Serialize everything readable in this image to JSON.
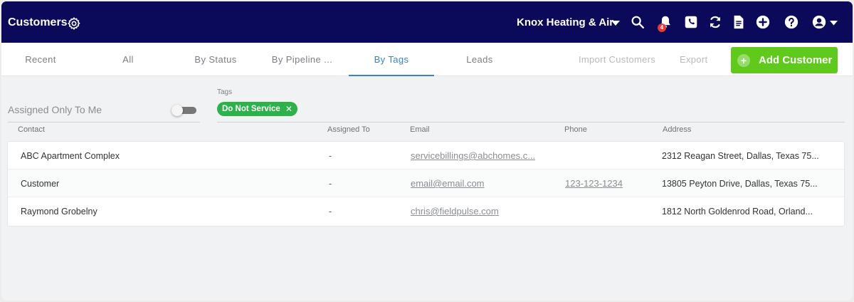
{
  "header": {
    "title": "Customers",
    "company": "Knox Heating & Air",
    "notification_count": "4",
    "icons": [
      "gear-icon",
      "caret-down-icon",
      "search-icon",
      "bell-icon",
      "phone-icon",
      "sync-icon",
      "document-icon",
      "plus-circle-icon",
      "help-icon",
      "user-account-icon"
    ]
  },
  "tabs": [
    {
      "label": "Recent"
    },
    {
      "label": "All"
    },
    {
      "label": "By Status"
    },
    {
      "label": "By Pipeline ..."
    },
    {
      "label": "By Tags"
    },
    {
      "label": "Leads"
    }
  ],
  "active_tab": "By Tags",
  "actions": {
    "import": "Import Customers",
    "export": "Export",
    "add": "Add Customer"
  },
  "filters": {
    "assigned_label": "Assigned Only To Me",
    "assigned_on": false,
    "tags_label": "Tags",
    "tag": "Do Not Service"
  },
  "table": {
    "columns": [
      "Contact",
      "Assigned To",
      "Email",
      "Phone",
      "Address"
    ],
    "rows": [
      {
        "contact": "ABC Apartment Complex",
        "assigned": "-",
        "email": "servicebillings@abchomes.c...",
        "phone": "",
        "address": "2312 Reagan Street, Dallas, Texas 75..."
      },
      {
        "contact": "Customer",
        "assigned": "-",
        "email": "email@email.com",
        "phone": "123-123-1234",
        "address": "13805 Peyton Drive, Dallas, Texas 75..."
      },
      {
        "contact": "Raymond Grobelny",
        "assigned": "-",
        "email": "chris@fieldpulse.com",
        "phone": "",
        "address": "1812 North Goldenrod Road, Orland..."
      }
    ]
  },
  "colors": {
    "header_bg": "#0b0a5a",
    "accent": "#3a82c4",
    "add_button": "#5fc91c",
    "tag_chip": "#2db14a",
    "badge": "#e53935"
  }
}
